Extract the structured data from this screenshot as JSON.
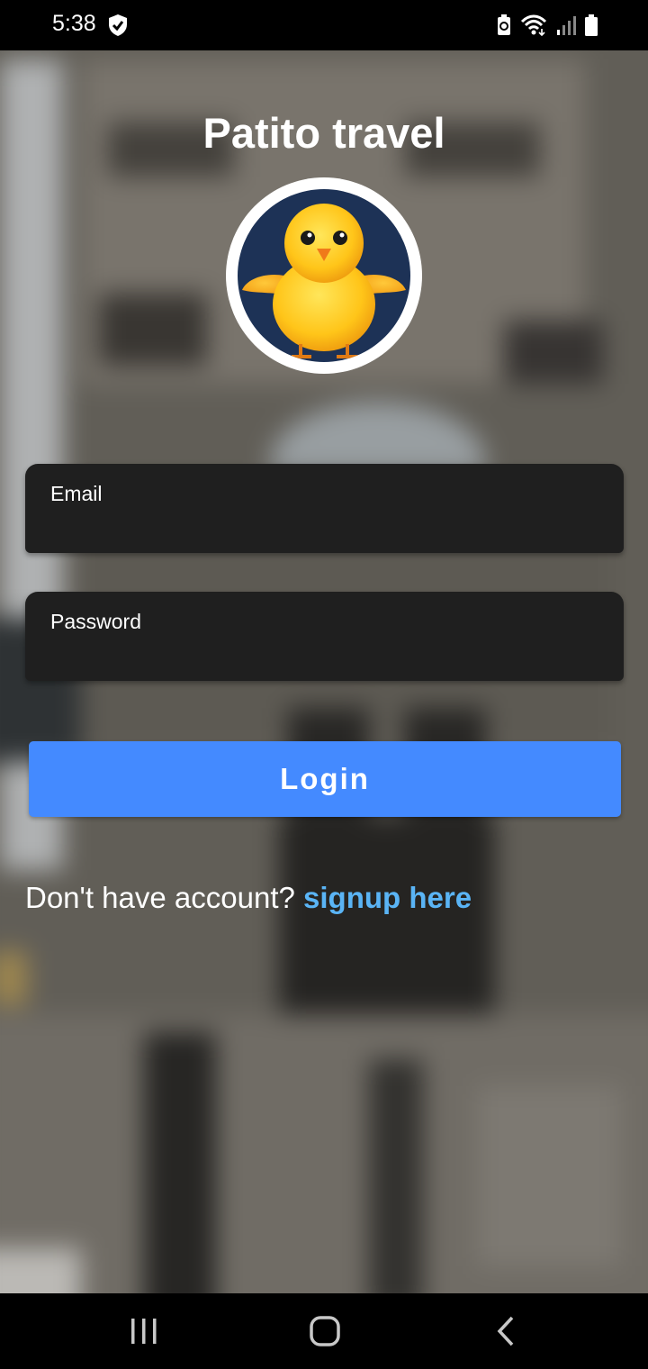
{
  "status_bar": {
    "time": "5:38",
    "icons": [
      "shield-check-icon",
      "data-saver-icon",
      "wifi-icon",
      "signal-icon",
      "battery-icon"
    ]
  },
  "app": {
    "title": "Patito travel",
    "logo": "duck-chick-icon"
  },
  "form": {
    "email_label": "Email",
    "email_value": "",
    "password_label": "Password",
    "password_value": "",
    "login_label": "Login"
  },
  "signup": {
    "prompt": "Don't have account? ",
    "link_label": "signup here"
  },
  "colors": {
    "input_bg": "#1f1f1f",
    "button": "#448aff",
    "link": "#5ab4f5"
  },
  "nav_bar": {
    "icons": [
      "recent-apps-icon",
      "home-icon",
      "back-icon"
    ]
  }
}
